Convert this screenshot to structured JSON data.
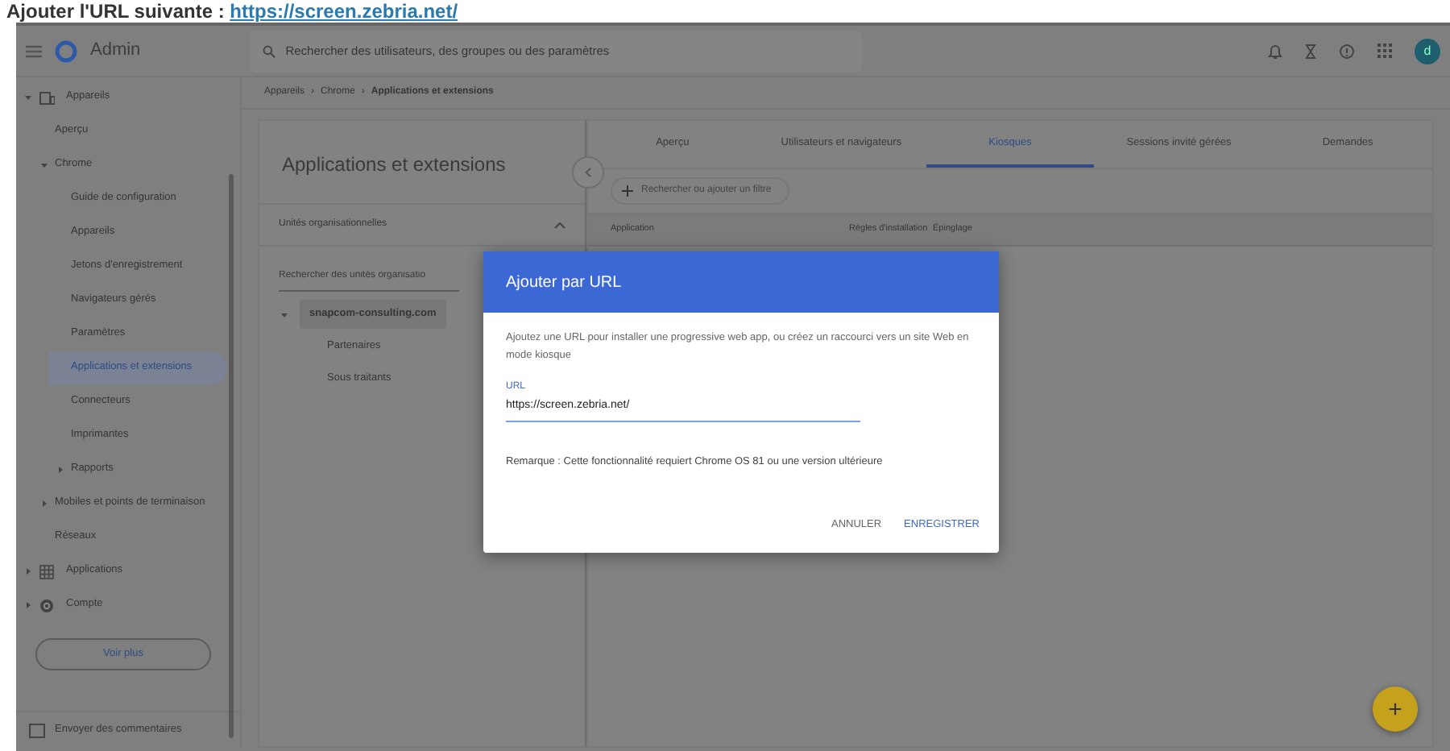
{
  "instruction": {
    "text": "Ajouter l'URL suivante :",
    "link": "https://screen.zebria.net/"
  },
  "topbar": {
    "product": "Admin",
    "search_placeholder": "Rechercher des utilisateurs, des groupes ou des paramètres",
    "avatar": "d"
  },
  "breadcrumb": [
    "Appareils",
    "Chrome",
    "Applications et extensions"
  ],
  "breadcrumb_separator": "›",
  "sidebar": {
    "items": [
      {
        "label": "Appareils",
        "expanded": true,
        "selected": false,
        "children": [
          {
            "label": "Aperçu",
            "selected": false
          },
          {
            "label": "Chrome",
            "expanded": true,
            "selected": false,
            "children": [
              {
                "label": "Guide de configuration",
                "selected": false
              },
              {
                "label": "Appareils",
                "selected": false
              },
              {
                "label": "Jetons d'enregistrement",
                "selected": false
              },
              {
                "label": "Navigateurs gérés",
                "selected": false
              },
              {
                "label": "Paramètres",
                "selected": false
              },
              {
                "label": "Applications et extensions",
                "selected": true
              },
              {
                "label": "Connecteurs",
                "selected": false
              },
              {
                "label": "Imprimantes",
                "selected": false
              },
              {
                "label": "Rapports",
                "expanded": false,
                "selected": false
              }
            ]
          },
          {
            "label": "Mobiles et points de terminaison",
            "expanded": false,
            "selected": false
          },
          {
            "label": "Réseaux",
            "selected": false
          }
        ]
      },
      {
        "label": "Applications",
        "expanded": false,
        "selected": false
      },
      {
        "label": "Compte",
        "expanded": false,
        "selected": false
      }
    ],
    "more_button": "Voir plus",
    "footer": "Envoyer des commentaires"
  },
  "left_panel": {
    "title": "Applications et extensions",
    "section": "Unités organisationnelles",
    "section_expanded": true,
    "search_placeholder": "Rechercher des unités organisatio",
    "org_tree": [
      {
        "label": "snapcom-consulting.com",
        "selected": true,
        "expanded": true,
        "children": [
          {
            "label": "Partenaires",
            "selected": false
          },
          {
            "label": "Sous traitants",
            "selected": false
          }
        ]
      }
    ]
  },
  "tabs": [
    {
      "label": "Aperçu",
      "selected": false
    },
    {
      "label": "Utilisateurs et navigateurs",
      "selected": false
    },
    {
      "label": "Kiosques",
      "selected": true
    },
    {
      "label": "Sessions invité gérées",
      "selected": false
    },
    {
      "label": "Demandes",
      "selected": false
    }
  ],
  "filter": {
    "placeholder": "Rechercher ou ajouter un filtre"
  },
  "table": {
    "columns": [
      "Application",
      "Règles d'installation",
      "Épinglage"
    ]
  },
  "dialog": {
    "title": "Ajouter par URL",
    "description": "Ajoutez une URL pour installer une progressive web app, ou créez un raccourci vers un site Web en mode kiosque",
    "field_label": "URL",
    "field_value": "https://screen.zebria.net/",
    "note": "Remarque : Cette fonctionnalité requiert Chrome OS 81 ou une version ultérieure",
    "buttons": [
      {
        "label": "ANNULER",
        "kind": "secondary"
      },
      {
        "label": "ENREGISTRER",
        "kind": "primary"
      }
    ]
  },
  "fab": "+"
}
